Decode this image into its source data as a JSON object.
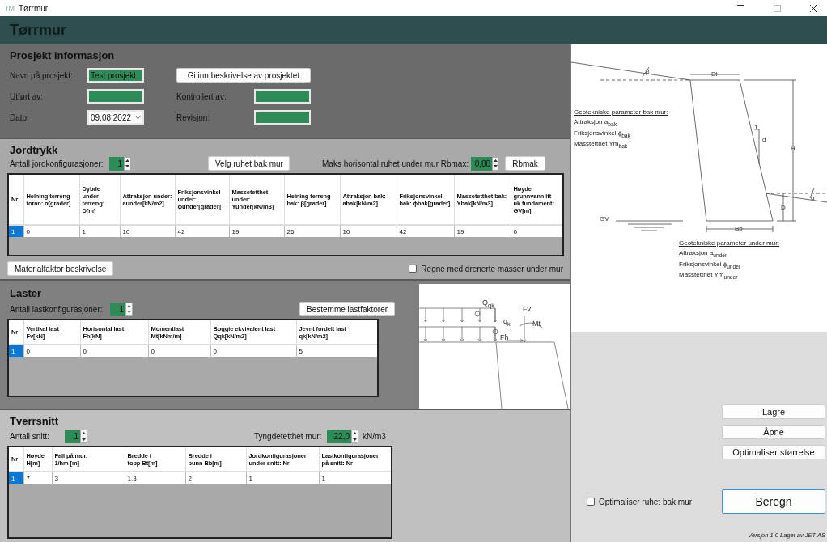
{
  "window": {
    "icon_text": "TM",
    "title": "Tørrmur"
  },
  "header": {
    "title": "Tørrmur"
  },
  "project": {
    "title": "Prosjekt informasjon",
    "name": {
      "label": "Navn på prosjekt:",
      "value": "Test prosjekt"
    },
    "performed_by": {
      "label": "Utført av:"
    },
    "date": {
      "label": "Dato:",
      "value": "09.08.2022"
    },
    "describe_button": "Gi inn beskrivelse av prosjektet",
    "checked_by": {
      "label": "Kontrollert av:"
    },
    "revision": {
      "label": "Revisjon:"
    }
  },
  "soil": {
    "title": "Jordtrykk",
    "count_label": "Antall jordkonfigurasjoner:",
    "count": "1",
    "roughness_button": "Velg ruhet bak mur",
    "rbmax_label": "Maks horisontal ruhet under mur Rbmax:",
    "rbmax": "0,80",
    "rbmax_button": "Rbmak",
    "columns": [
      "Nr",
      "Helning terreng foran: α[grader]",
      "Dybde under terreng: D[m]",
      "Attraksjon under: aunder[kN/m2]",
      "Friksjonsvinkel under: ϕunder[grader]",
      "Massetetthet under: Yunder[kN/m3]",
      "Helning terreng bak: β[grader]",
      "Attraksjon bak: abak[kN/m2]",
      "Friksjonsvinkel bak: ϕbak[grader]",
      "Massetetthet bak: Ybak[kN/m3]",
      "Høyde grunnvann ift uk fundament: GV[m]"
    ],
    "rows": [
      {
        "selected": true,
        "cells": [
          "1",
          "0",
          "1",
          "10",
          "42",
          "19",
          "26",
          "10",
          "42",
          "19",
          "0"
        ]
      }
    ],
    "material_button": "Materialfaktor beskrivelse",
    "drained": {
      "label": "Regne med drenerte masser under mur",
      "checked": false
    }
  },
  "loads": {
    "title": "Laster",
    "count_label": "Antall lastkonfigurasjoner:",
    "count": "1",
    "factors_button": "Bestemme lastfaktorer",
    "columns": [
      "Nr",
      "Vertikal last\nFv[kN]",
      "Horisontal last\nFh[kN]",
      "Momentlast\nMt[kNm/m]",
      "Boggie ekvivalent last\nQqk[kN/m2]",
      "Jevnt fordelt last\nqk[kN/m2]"
    ],
    "rows": [
      {
        "selected": true,
        "cells": [
          "1",
          "0",
          "0",
          "0",
          "0",
          "5"
        ]
      }
    ],
    "diagram_labels": [
      "Q$_{qk}$",
      "q$_{k}$",
      "Fv",
      "Mt",
      "Fh"
    ]
  },
  "sections": {
    "title": "Tverrsnitt",
    "count_label": "Antall snitt:",
    "count": "1",
    "density_label": "Tyngdetetthet mur:",
    "density": "22,0",
    "density_unit": "kN/m3",
    "columns": [
      "Nr",
      "Høyde\nH[m]",
      "Fall på mur.\n1/hm [m]",
      "Bredde i\ntopp Bt[m]",
      "Bredde i\nbunn Bb[m]",
      "Jordkonfigurasjoner\nunder snitt: Nr",
      "Lastkonfigurasjoner\npå snitt: Nr"
    ],
    "rows": [
      {
        "selected": true,
        "cells": [
          "1",
          "7",
          "3",
          "1,3",
          "2",
          "1",
          "1"
        ]
      }
    ]
  },
  "wall_diagram": {
    "dimension_labels": [
      "Bt",
      "1",
      "d",
      "H",
      "D",
      "Bb",
      "GV",
      "β",
      "α"
    ],
    "behind": {
      "title": "Geotekniske parameter bak mur:",
      "lines": [
        "Attraksjon a$_{bak}$",
        "Friksjonsvinkel ϕ$_{bak}$",
        "Masstetthet Ym$_{bak}$"
      ]
    },
    "under": {
      "title": "Geotekniske parameter under mur:",
      "lines": [
        "Attraksjon a$_{under}$",
        "Friksjonsvinkel ϕ$_{under}$",
        "Masstetthet Ym$_{under}$"
      ]
    }
  },
  "actions": {
    "buttons": [
      "Lagre",
      "Åpne",
      "Optimaliser størrelse"
    ],
    "optimize_roughness": {
      "label": "Optimaliser ruhet bak mur",
      "checked": false
    },
    "calculate": "Beregn",
    "version": "Versjon 1.0  Laget av JET AS"
  }
}
